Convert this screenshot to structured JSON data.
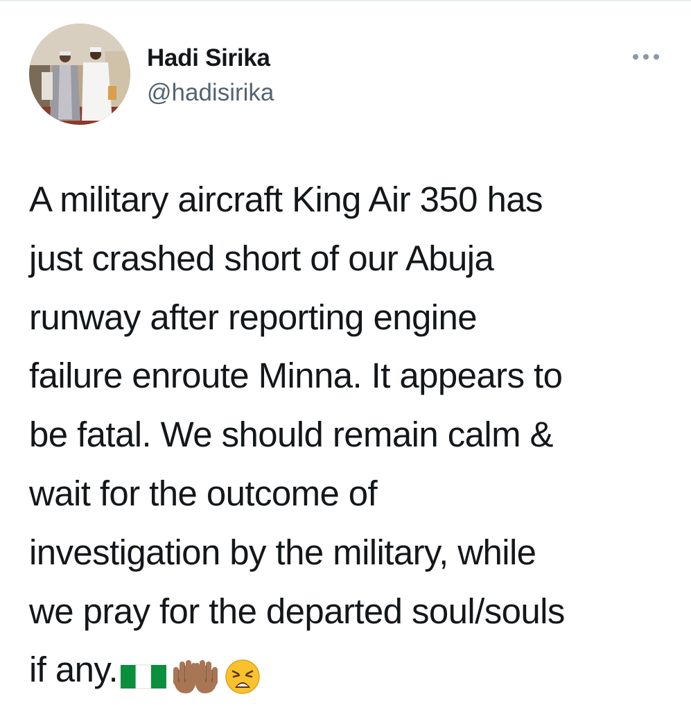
{
  "tweet": {
    "author": {
      "display_name": "Hadi Sirika",
      "handle": "@hadisirika",
      "avatar_icon": "profile-photo"
    },
    "more_icon": "more-horizontal-icon",
    "text": "A military aircraft King Air 350 has\njust crashed short of our Abuja\nrunway after reporting engine\nfailure enroute Minna. It appears to\nbe fatal. We should remain calm &\nwait for the outcome of\ninvestigation by the military, while\nwe pray for the departed soul/souls\nif any.",
    "emojis": [
      "nigeria-flag-emoji",
      "raised-hands-emoji",
      "weary-face-emoji"
    ]
  },
  "colors": {
    "handle": "#536471",
    "text": "#14171a",
    "more_dots": "#8b98a5"
  }
}
